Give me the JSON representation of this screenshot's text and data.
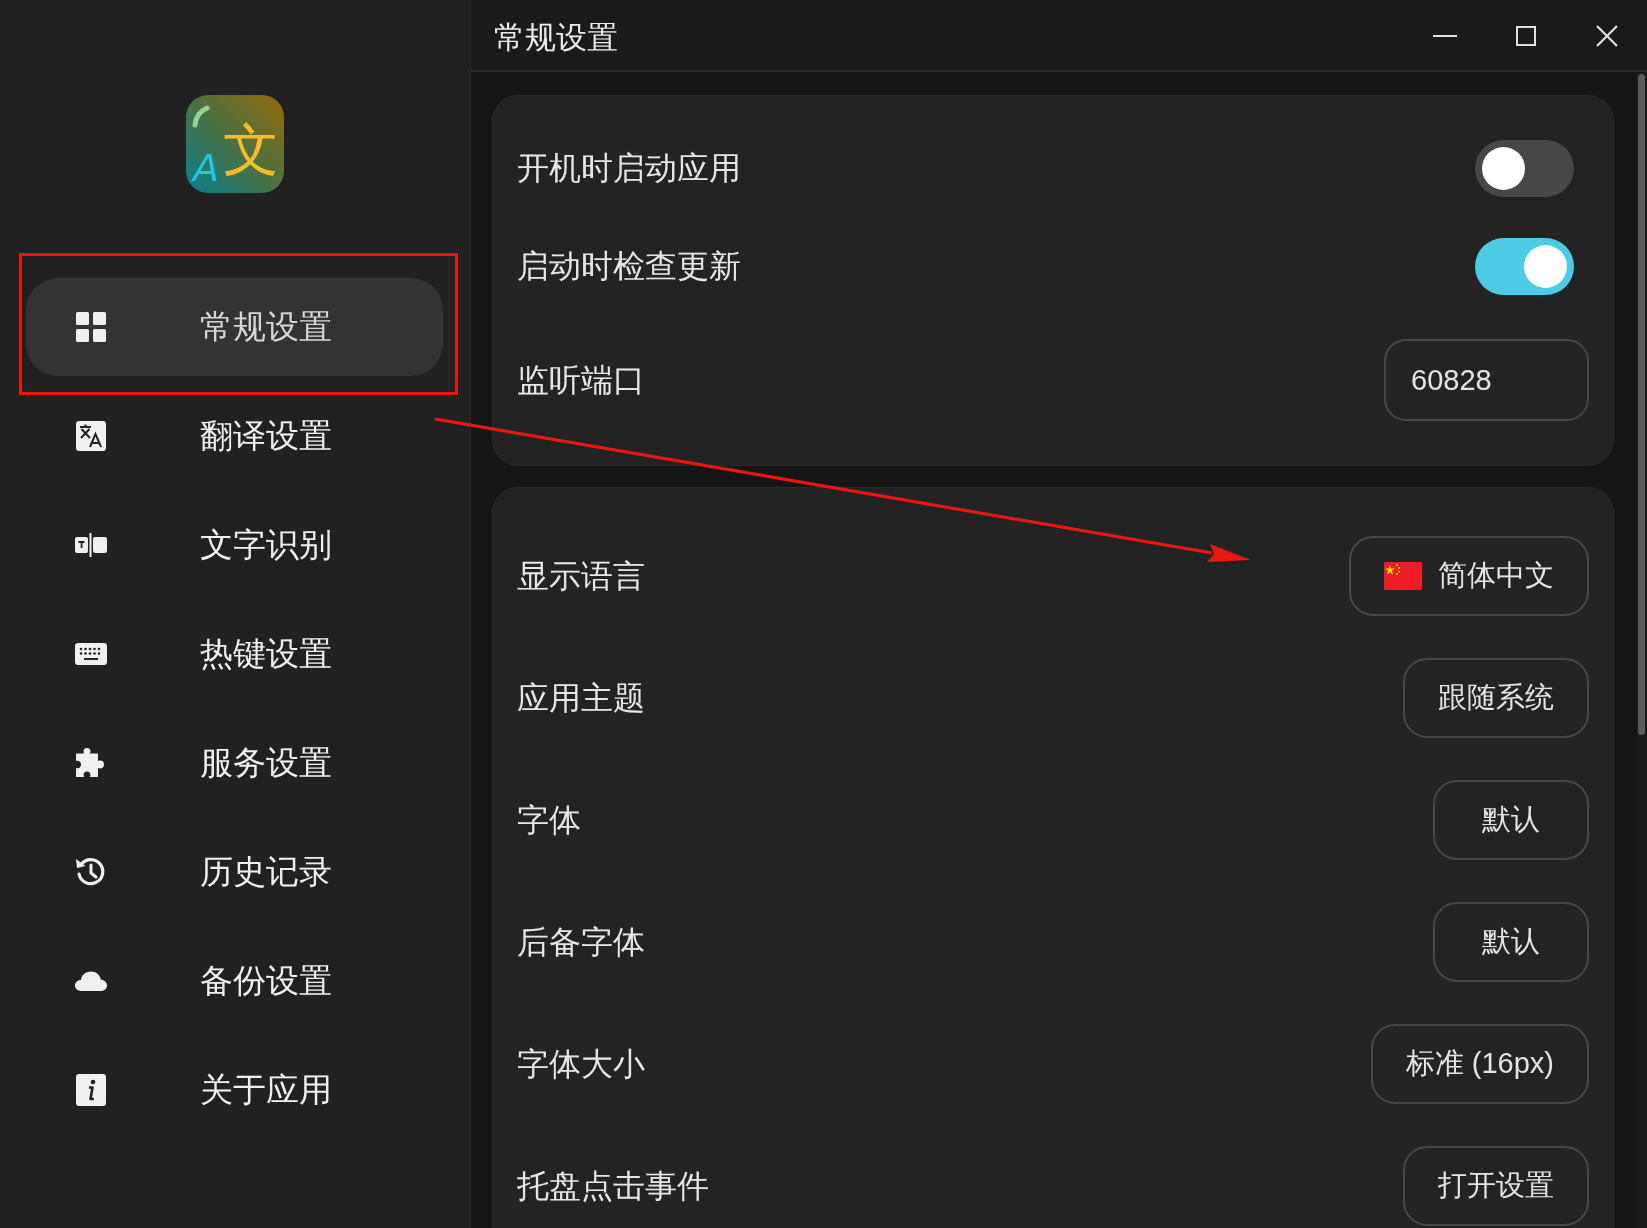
{
  "window": {
    "title": "常规设置"
  },
  "sidebar": {
    "logo": {
      "letters": [
        "A",
        "文"
      ]
    },
    "items": [
      {
        "label": "常规设置",
        "selected": true,
        "framed": true
      },
      {
        "label": "翻译设置",
        "selected": false,
        "framed": false
      },
      {
        "label": "文字识别",
        "selected": false,
        "framed": false
      },
      {
        "label": "热键设置",
        "selected": false,
        "framed": false
      },
      {
        "label": "服务设置",
        "selected": false,
        "framed": false
      },
      {
        "label": "历史记录",
        "selected": false,
        "framed": false
      },
      {
        "label": "备份设置",
        "selected": false,
        "framed": false
      },
      {
        "label": "关于应用",
        "selected": false,
        "framed": false
      }
    ]
  },
  "sections": [
    {
      "rows": [
        {
          "kind": "toggle",
          "label": "开机时启动应用",
          "on": false
        },
        {
          "kind": "toggle",
          "label": "启动时检查更新",
          "on": true
        },
        {
          "kind": "input",
          "label": "监听端口",
          "value": "60828"
        }
      ]
    },
    {
      "rows": [
        {
          "kind": "language",
          "label": "显示语言",
          "value": "简体中文"
        },
        {
          "kind": "button",
          "label": "应用主题",
          "value": "跟随系统"
        },
        {
          "kind": "button",
          "label": "字体",
          "value": "默认"
        },
        {
          "kind": "button",
          "label": "后备字体",
          "value": "默认"
        },
        {
          "kind": "button",
          "label": "字体大小",
          "value": "标准 (16px)"
        },
        {
          "kind": "button",
          "label": "托盘点击事件",
          "value": "打开设置"
        }
      ]
    }
  ],
  "annotation_arrow": true
}
